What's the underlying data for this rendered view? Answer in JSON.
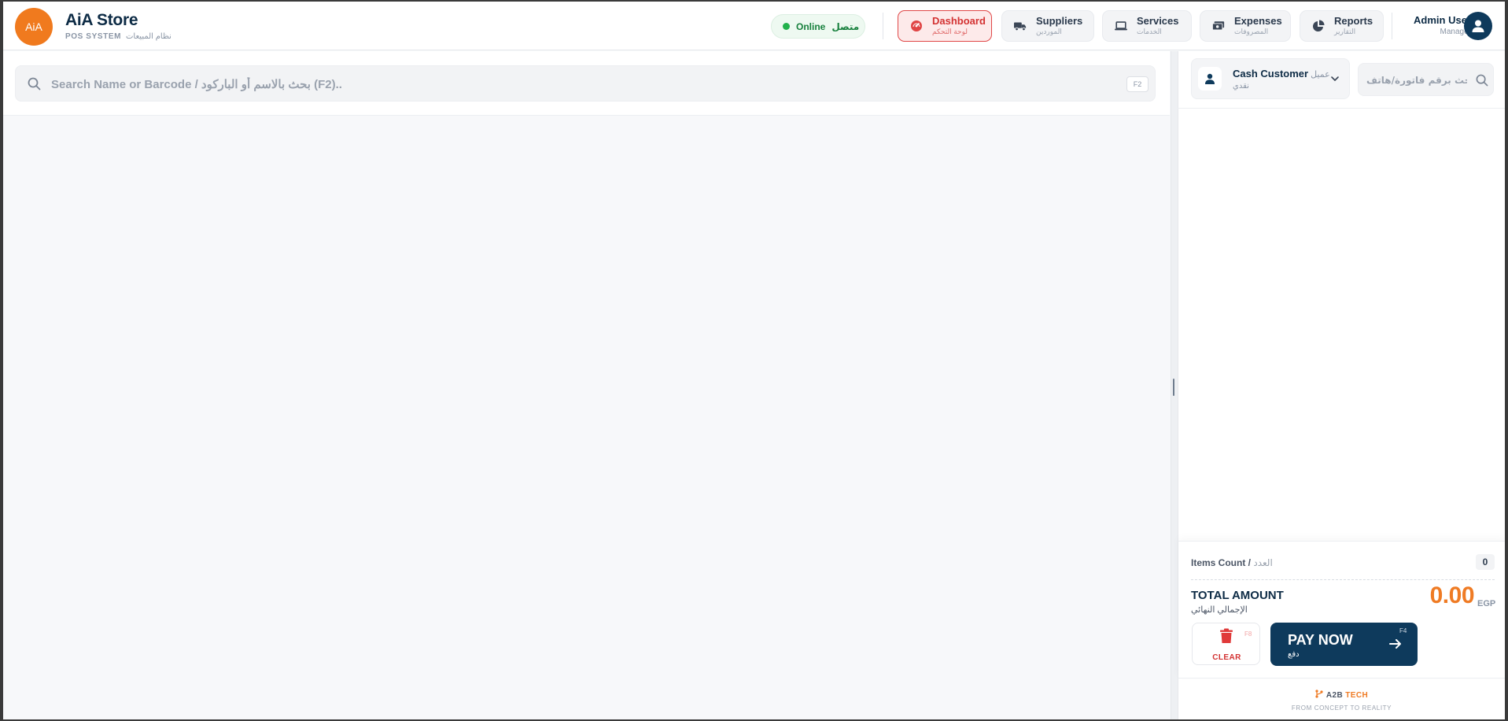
{
  "brand": {
    "logo_text": "AiA",
    "name": "AiA Store",
    "subtitle": "POS SYSTEM",
    "subtitle_ar": "نظام المبيعات"
  },
  "status": {
    "label": "Online",
    "label_ar": "متصل",
    "color": "#22b14c"
  },
  "nav": [
    {
      "label": "Dashboard",
      "sub": "لوحة التحكم",
      "icon": "speedometer-icon",
      "active": true
    },
    {
      "label": "Suppliers",
      "sub": "الموردين",
      "icon": "truck-icon",
      "active": false
    },
    {
      "label": "Services",
      "sub": "الخدمات",
      "icon": "laptop-icon",
      "active": false
    },
    {
      "label": "Expenses",
      "sub": "المصروفات",
      "icon": "money-icon",
      "active": false
    },
    {
      "label": "Reports",
      "sub": "التقارير",
      "icon": "pie-chart-icon",
      "active": false
    }
  ],
  "user": {
    "name": "Admin User",
    "role": "Manager"
  },
  "search": {
    "placeholder": "Search Name or Barcode / بحث بالاسم أو الباركود (F2)..",
    "shortcut": "F2"
  },
  "customer": {
    "name": "Cash Customer",
    "name_ar": "عميل",
    "sub": "نقدي"
  },
  "invoice_search": {
    "placeholder": "بحث برقم فاتورة/هاتف..."
  },
  "summary": {
    "items_label": "Items Count",
    "items_label_ar": "العدد",
    "items_count": "0",
    "total_label": "TOTAL AMOUNT",
    "total_label_ar": "الإجمالي النهائي",
    "total_value": "0.00",
    "currency": "EGP"
  },
  "actions": {
    "clear_label": "CLEAR",
    "clear_shortcut": "F8",
    "pay_label": "PAY NOW",
    "pay_sub": "دفع",
    "pay_shortcut": "F4"
  },
  "footer": {
    "brand_a": "A2B",
    "brand_b": "TECH",
    "tagline": "FROM CONCEPT TO REALITY"
  },
  "colors": {
    "accent": "#f07a1e",
    "primary": "#0e3a5c",
    "danger": "#d33232"
  }
}
